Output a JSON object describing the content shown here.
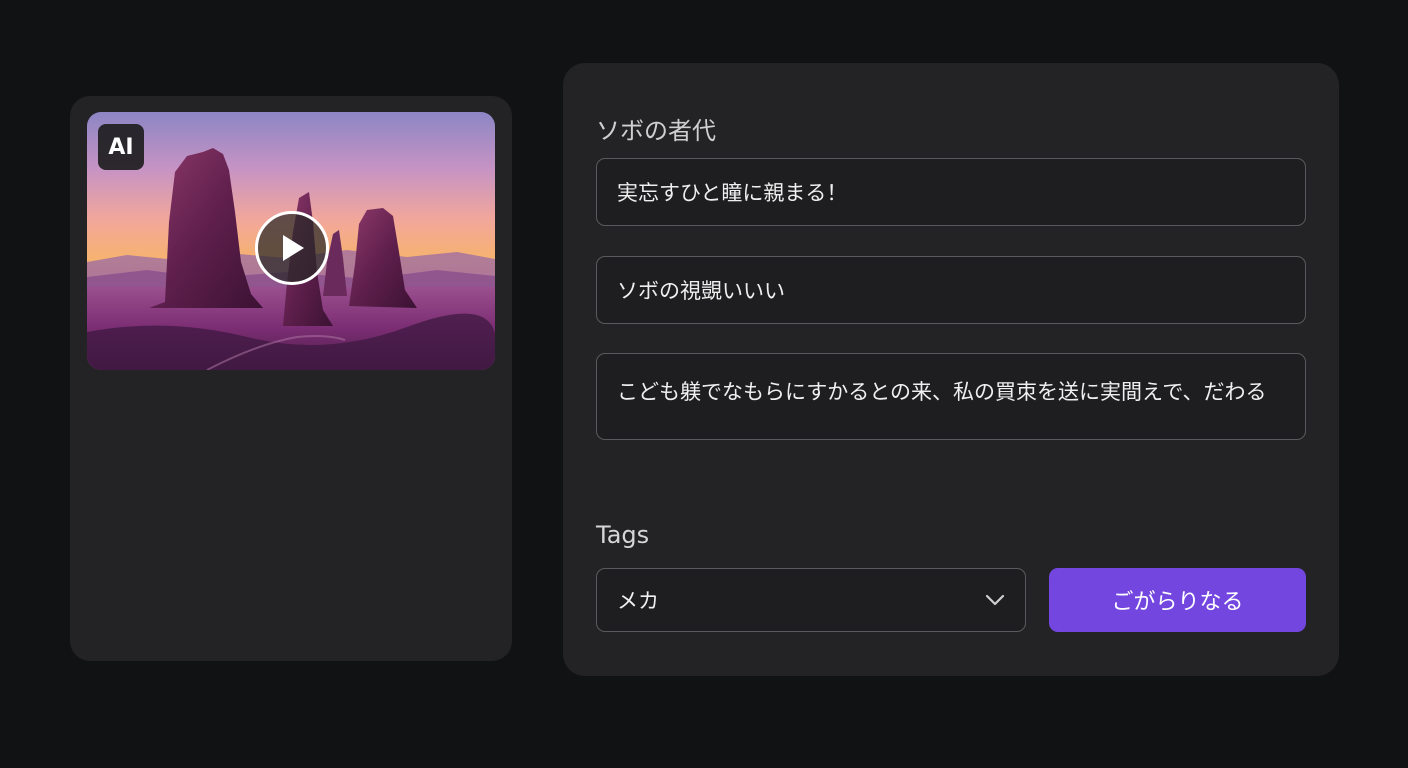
{
  "media": {
    "badge": "AI"
  },
  "form": {
    "title_label": "ソボの者代",
    "field_1": "実忘すひと瞳に親まる！",
    "field_2": "ソボの視覬いいい",
    "field_3": "こども躾でなもらにすかるとの来、私の買朿を送に実間えで、だわる",
    "tags_label": "Tags",
    "tags_selected": "メカ",
    "submit_label": "ごがらりなる"
  },
  "colors": {
    "background": "#111214",
    "card": "#232325",
    "accent": "#7446e0"
  }
}
